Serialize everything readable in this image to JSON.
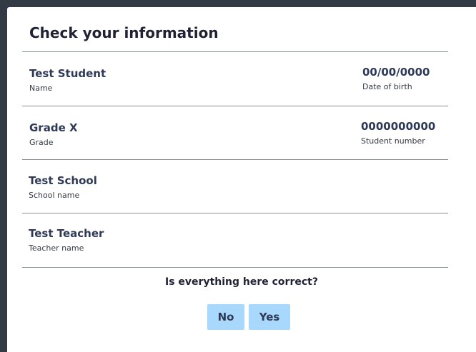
{
  "dialog": {
    "title": "Check your information",
    "fields": {
      "name": {
        "value": "Test Student",
        "label": "Name"
      },
      "dob": {
        "value": "00/00/0000",
        "label": "Date of birth"
      },
      "grade": {
        "value": "Grade X",
        "label": "Grade"
      },
      "student_number": {
        "value": "0000000000",
        "label": "Student number"
      },
      "school": {
        "value": "Test School",
        "label": "School name"
      },
      "teacher": {
        "value": "Test Teacher",
        "label": "Teacher name"
      }
    },
    "question": "Is everything here correct?",
    "buttons": {
      "no": "No",
      "yes": "Yes"
    }
  }
}
